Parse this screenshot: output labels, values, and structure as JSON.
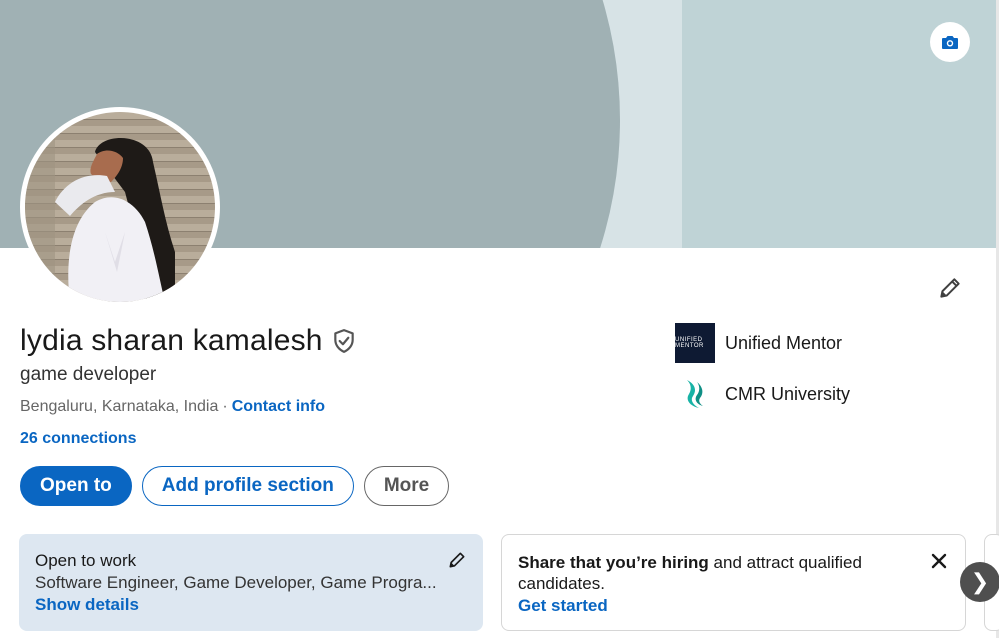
{
  "profile": {
    "name": "lydia sharan kamalesh",
    "headline": "game developer",
    "location": "Bengaluru, Karnataka, India",
    "separator": "·",
    "contact_info_label": "Contact info",
    "connections_label": "26 connections"
  },
  "actions": {
    "open_to_label": "Open to",
    "add_profile_section_label": "Add profile section",
    "more_label": "More"
  },
  "orgs": [
    {
      "name": "Unified Mentor",
      "logo_text": "UNIFIED MENTOR",
      "icon": "unified-mentor-logo"
    },
    {
      "name": "CMR University",
      "icon": "cmr-university-logo"
    }
  ],
  "cards": {
    "open_to_work": {
      "title": "Open to work",
      "roles": "Software Engineer, Game Developer, Game Progra...",
      "link_label": "Show details"
    },
    "hiring": {
      "title_bold": "Share that you’re hiring",
      "title_rest": " and attract qualified candidates.",
      "link_label": "Get started"
    }
  },
  "icons": {
    "camera": "camera-icon",
    "edit": "pencil-icon",
    "verified": "shield-check-icon",
    "close": "close-icon",
    "next": "chevron-right-icon"
  },
  "next_glyph": "❯",
  "colors": {
    "accent": "#0a66c2",
    "banner_left": "#a0b1b4",
    "banner_mid": "#d7e3e6",
    "banner_right": "#bfd3d6",
    "open_to_work_bg": "#dde7f1"
  }
}
